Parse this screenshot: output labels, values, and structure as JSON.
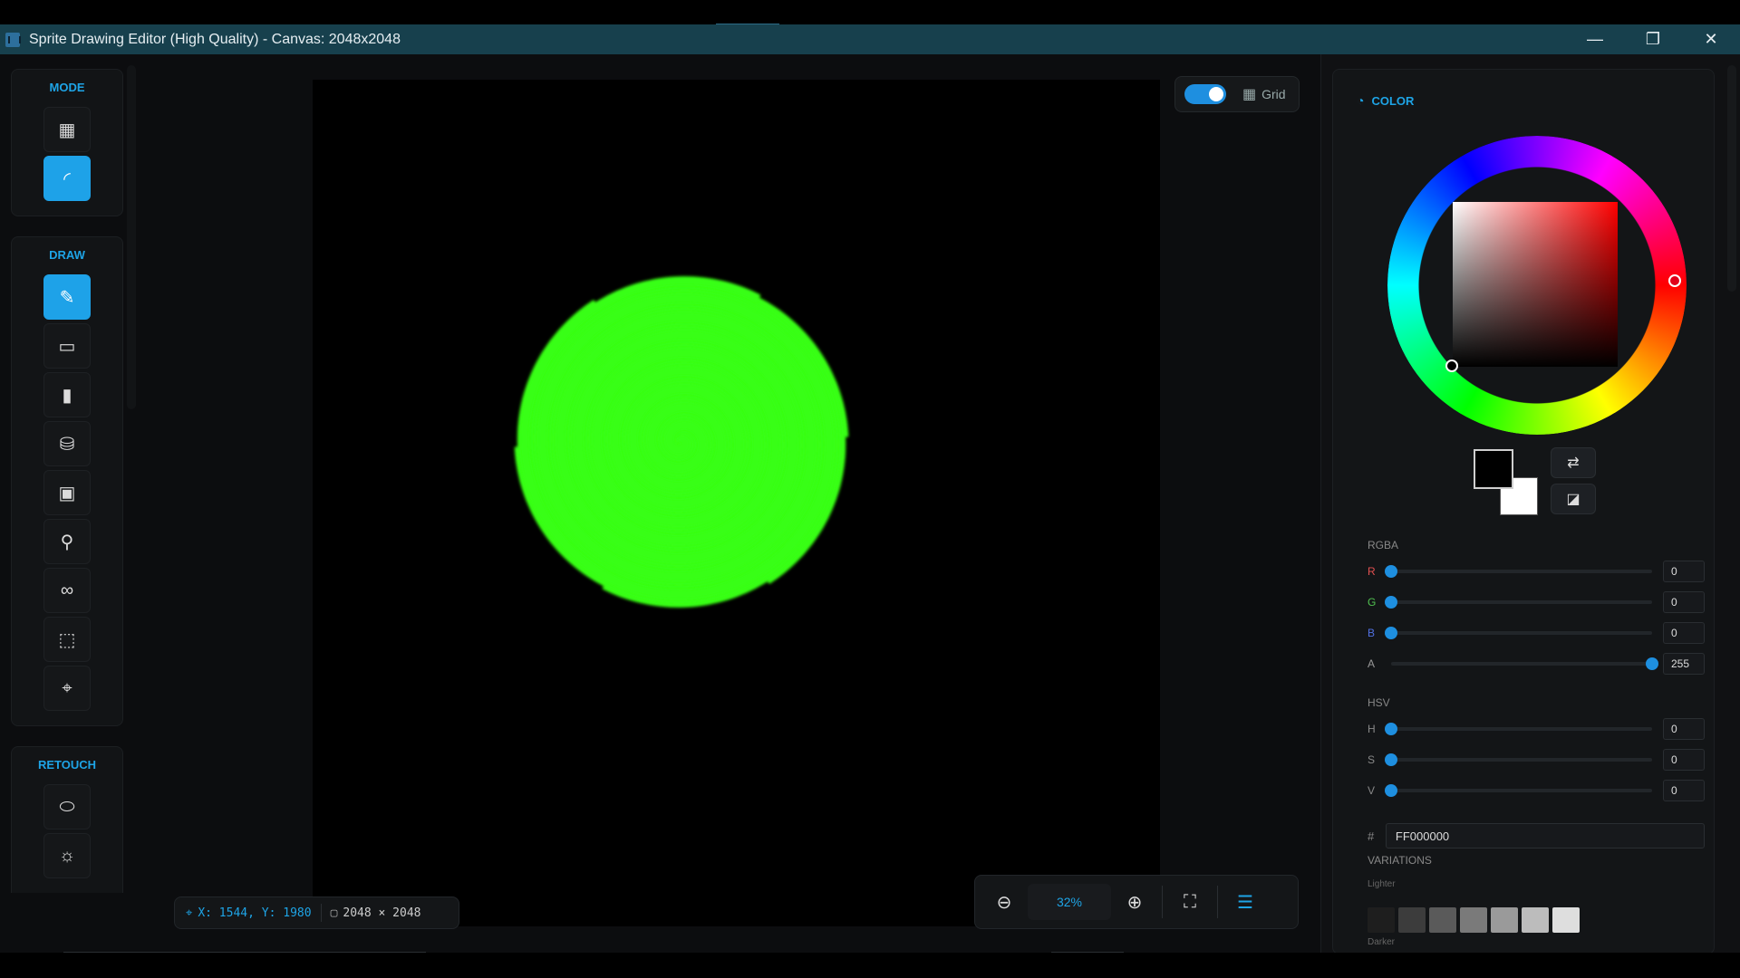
{
  "window": {
    "title": "Sprite Drawing Editor (High Quality) - Canvas: 2048x2048",
    "minimize": "—",
    "maximize": "❐",
    "close": "✕"
  },
  "left_toolbar": {
    "mode_label": "MODE",
    "draw_label": "DRAW",
    "retouch_label": "RETOUCH",
    "mode_tools": [
      {
        "icon": "grid-icon",
        "glyph": "▦",
        "active": false
      },
      {
        "icon": "curve-icon",
        "glyph": "◜",
        "active": true
      }
    ],
    "draw_tools": [
      {
        "icon": "pencil-icon",
        "glyph": "✎",
        "active": true
      },
      {
        "icon": "eraser-icon",
        "glyph": "▭",
        "active": false
      },
      {
        "icon": "spray-icon",
        "glyph": "▮",
        "active": false
      },
      {
        "icon": "fill-bucket-icon",
        "glyph": "⛁",
        "active": false
      },
      {
        "icon": "rectangle-icon",
        "glyph": "▣",
        "active": false
      },
      {
        "icon": "eyedropper-icon",
        "glyph": "⚲",
        "active": false
      },
      {
        "icon": "link-icon",
        "glyph": "∞",
        "active": false
      },
      {
        "icon": "selection-icon",
        "glyph": "⬚",
        "active": false
      },
      {
        "icon": "transform-icon",
        "glyph": "⌖",
        "active": false
      }
    ],
    "retouch_tools": [
      {
        "icon": "smudge-icon",
        "glyph": "⬭"
      },
      {
        "icon": "brightness-icon",
        "glyph": "☼"
      }
    ]
  },
  "canvas": {
    "grid_label": "Grid",
    "grid_on": true,
    "coords": "X: 1544, Y: 1980",
    "size": "2048 × 2048",
    "zoom": "32%"
  },
  "color_panel": {
    "title": "COLOR",
    "rgba_label": "RGBA",
    "hsv_label": "HSV",
    "rgba": [
      {
        "ch": "R",
        "color": "#e05050",
        "value": "0",
        "fraction": 0
      },
      {
        "ch": "G",
        "color": "#50c050",
        "value": "0",
        "fraction": 0
      },
      {
        "ch": "B",
        "color": "#5070e0",
        "value": "0",
        "fraction": 0
      },
      {
        "ch": "A",
        "color": "#999999",
        "value": "255",
        "fraction": 1
      }
    ],
    "hsv": [
      {
        "ch": "H",
        "value": "0",
        "fraction": 0
      },
      {
        "ch": "S",
        "value": "0",
        "fraction": 0
      },
      {
        "ch": "V",
        "value": "0",
        "fraction": 0
      }
    ],
    "hex_prefix": "#",
    "hex": "FF000000",
    "variations_label": "VARIATIONS",
    "lighter_label": "Lighter",
    "darker_label": "Darker",
    "lighter_swatches": [
      "#1e1e1e",
      "#3c3c3c",
      "#5a5a5a",
      "#7a7a7a",
      "#9a9a9a",
      "#bcbcbc",
      "#dedede"
    ]
  }
}
